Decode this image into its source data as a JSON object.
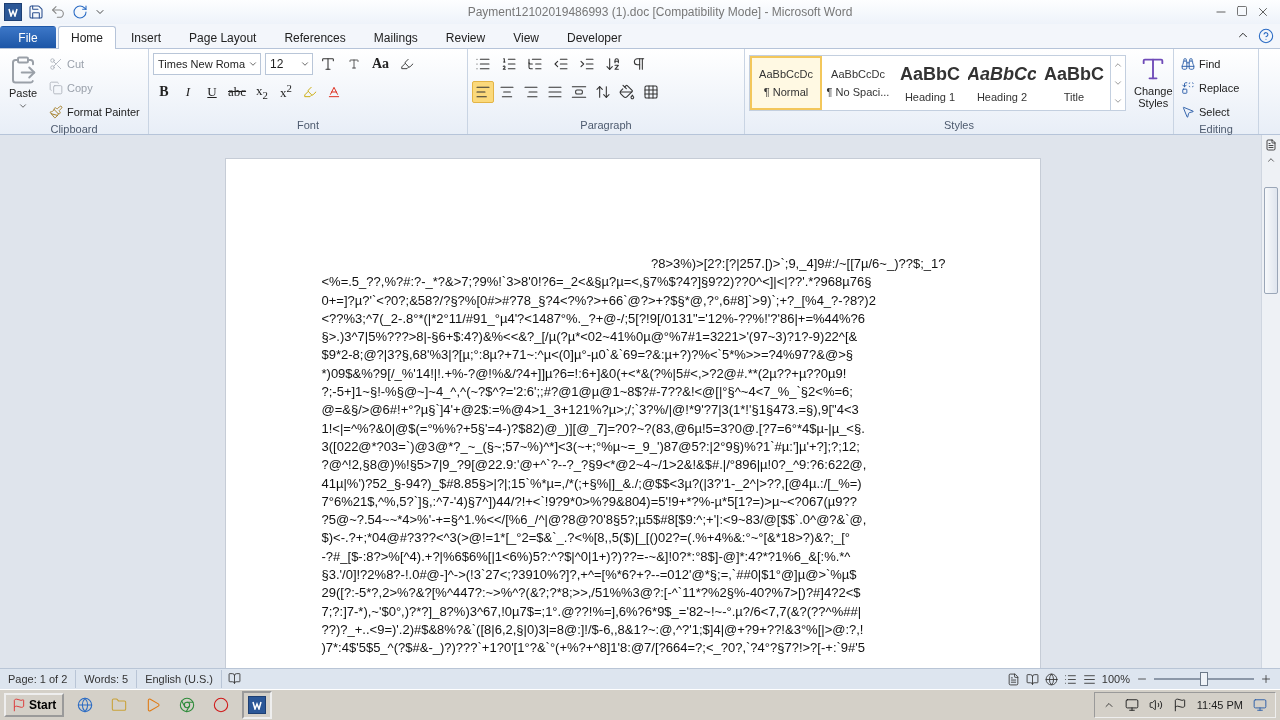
{
  "title_bar": {
    "title": "Payment12102019486993 (1).doc [Compatibility Mode]  -  Microsoft Word"
  },
  "tabs": [
    {
      "label": "File",
      "kind": "file",
      "selected": false
    },
    {
      "label": "Home",
      "kind": "tab",
      "selected": true
    },
    {
      "label": "Insert",
      "kind": "tab",
      "selected": false
    },
    {
      "label": "Page Layout",
      "kind": "tab",
      "selected": false
    },
    {
      "label": "References",
      "kind": "tab",
      "selected": false
    },
    {
      "label": "Mailings",
      "kind": "tab",
      "selected": false
    },
    {
      "label": "Review",
      "kind": "tab",
      "selected": false
    },
    {
      "label": "View",
      "kind": "tab",
      "selected": false
    },
    {
      "label": "Developer",
      "kind": "tab",
      "selected": false
    }
  ],
  "clipboard": {
    "label": "Clipboard",
    "paste": "Paste",
    "commands": [
      {
        "label": "Cut",
        "kind": "cut",
        "disabled": true
      },
      {
        "label": "Copy",
        "kind": "copy",
        "disabled": true
      },
      {
        "label": "Format Painter",
        "kind": "painter",
        "disabled": false
      }
    ]
  },
  "font": {
    "label": "Font",
    "font_name": "Times New Roma",
    "font_size": "12",
    "format_buttons": [
      {
        "label": "B",
        "kind": "bold"
      },
      {
        "label": "I",
        "kind": "italic"
      },
      {
        "label": "U",
        "kind": "underline"
      },
      {
        "label": "abc",
        "kind": "strike"
      },
      {
        "label": "x$_{2}$",
        "kind": "script"
      },
      {
        "label": "x$^{2}$",
        "kind": "script"
      }
    ],
    "case_button": "Aa"
  },
  "paragraph": {
    "label": "Paragraph",
    "alignments": [
      {
        "selected": true
      },
      {
        "selected": false
      },
      {
        "selected": false
      },
      {
        "selected": false
      },
      {
        "selected": false
      }
    ]
  },
  "styles": {
    "label": "Styles",
    "items": [
      {
        "preview": "AaBbCcDc",
        "name": "¶ Normal",
        "kind": "normal",
        "selected": true
      },
      {
        "preview": "AaBbCcDc",
        "name": "¶ No Spaci...",
        "kind": "normal",
        "selected": false
      },
      {
        "preview": "AaBbC",
        "name": "Heading 1",
        "kind": "heading",
        "selected": false
      },
      {
        "preview": "AaBbCc",
        "name": "Heading 2",
        "kind": "italic",
        "selected": false
      },
      {
        "preview": "AaBbC",
        "name": "Title",
        "kind": "heading",
        "selected": false
      }
    ],
    "change_styles": "Change Styles"
  },
  "editing": {
    "label": "Editing",
    "commands": [
      {
        "label": "Find",
        "kind": "find"
      },
      {
        "label": "Replace",
        "kind": "replace"
      },
      {
        "label": "Select",
        "kind": "select"
      }
    ]
  },
  "document": {
    "lines": [
      "?8>3%)>[2?:[?|257.[)>`;9,_4]9#:/~[[7µ/6~_)??$;_1?",
      "<%=.5_??,%?#:?-_*?&>7;?9%!`3>8'0!?6=_2<&§µ?µ=<,§7%$?4?]§9?2)??0^<]|<|??'.*?968µ76§",
      "0+=]?µ?'`<?0?;&58?/?§?%[0#>#?78_§?4<?%?>+66`@?>+?$§*@,?°,6#8]`>9)`;+?_[%4_?-?8?)2",
      "<??%3;^7(_2-.8°*(|*2°11/#91_°µ4'?<1487°%._?+@-/;5[?!9[/0131\"='12%-??%!'?'86|+=%44%?6",
      "§>.)3^7|5%???>8|-§6+$:4?)&%<<&?_[/µ(?µ*<02~41%0µ@°%7#1=3221>'(97~3)?1?-9)22^[&",
      "$9*2-8;@?|3?§,68'%3|?[µ;°:8µ?+71~:^µ<(0]µ°-µ0`&`69=?&:µ+?)?%<`5*%>>=?4%97?&@>§",
      "*)09$&%?9[/_%'14!|!.+%-?@!%&/?4+]]µ?6=!:6+]&0(+<*&(?%|5#<,>?2@#.**(2µ??+µ??0µ9!",
      "?;-5+]1~§!-%§@~]~4_^,^(~?$^?='2:6';;#?@1@µ@1~8$?#-7??&!<@[|°§^~4<7_%_`§2<%=6;",
      "@=&§/>@6#!+°?µ§`]4'+@2$:=%@4>1_3+121%?µ>;/;`3?%/|@!*9'?7|3(1*!'§1§473.=§),9[\"4<3",
      "1!<|=^%?&0|@$(=°%%?+5§'=4-)?$82)@_)][@_7]=?0?~?(83,@6µ!5=3?0@.[?7=6°*4$µ-|µ_<§.",
      "3([022@*?03=`)@3@*?_~_(§~;57~%)^*]<3(~+;°%µ~=_9_')87@5?:|2°9§)%?1`#µ:']µ'+?];?;12;",
      "?@^!2,§8@)%!§5>7|9_?9[@22.9:'@+^`?--?_?§9<*@2~4~/1>2&!&$#.|/°896|µ!0?_^9:?6:622@,",
      "41µ|%')?52_§-94?)_$#8.85§>|?|;15`%*µ=,/*(;+§%|]_&./;@$$<3µ?(|3?'1-_2^|>??,[@4µ.:/[_%=)",
      "7°6%21$,^%,5?`]§,:^7-'4)§7^])44/?!+<`!9?9*0>%?9&804)=5'!9+*?%-µ*5[1?=)>µ~<?067(µ9??",
      "?5@~?.54~~*4>%'-+=§^1.%<</[%6_/^|@?8@?0'8§5?;µ5$#8[$9:^;+'|:<9~83/@[$$`.0^@?&`@,",
      "$)<-.?+;*04@#?3??<^3(>@!=1*[_°2=$&`_.?<%[8,,5($)[_[()02?=(.%+4%&:°~°[&*18>?)&?;_[°",
      "-?#_[$-:8?>%[^4).+?|%6$6%[|1<6%)5?:^?$|^0|1+)?)??=-~&]!0?*:°8$]-@]*:4?*?1%6_&[:%.*^",
      "§3.'/0]!?2%8?-!.0#@-]^->(!3`27<;?3910%?]?,+^=[%*6?+?--=012'@*§;=,`##0|$1°@]µ@>`%µ$",
      "29([?:-5*?,2>%?&?[%^447?:~>%^?(&?;?*8;>>,/51%%3@?:[-^`11*?%2§%-40?%7>[)?#]4?2<$",
      "7;?:]7-*),~'$0°,)?*?]_8?%)3^67,!0µ7$=;1°.@??!%=],6%?6*9$_='82~!~-°.µ?/6<7,7(&?(??^%##|",
      "??)?_+..<9=)'.2)#$&8%?&`([8|6,2,§|0)3|=8@:]!/$-6,,8&1?~:@,^?'1;$]4|@+?9+??!&3°%[|>@:?,!",
      ")7*:4$'5$5_^(?$#&-_)?)???`+1?0'[1°?&`°(+%?+^8]1'8:@7/[?664=?;<_?0?,`?4°?§7?!>?[-+:`9#'5"
    ]
  },
  "status_bar": {
    "page": "Page: 1 of 2",
    "words": "Words: 5",
    "language": "English (U.S.)",
    "zoom": "100%",
    "zoom_slider": {
      "level": 0.5
    }
  },
  "taskbar": {
    "start": "Start",
    "clock": "11:45 PM"
  }
}
